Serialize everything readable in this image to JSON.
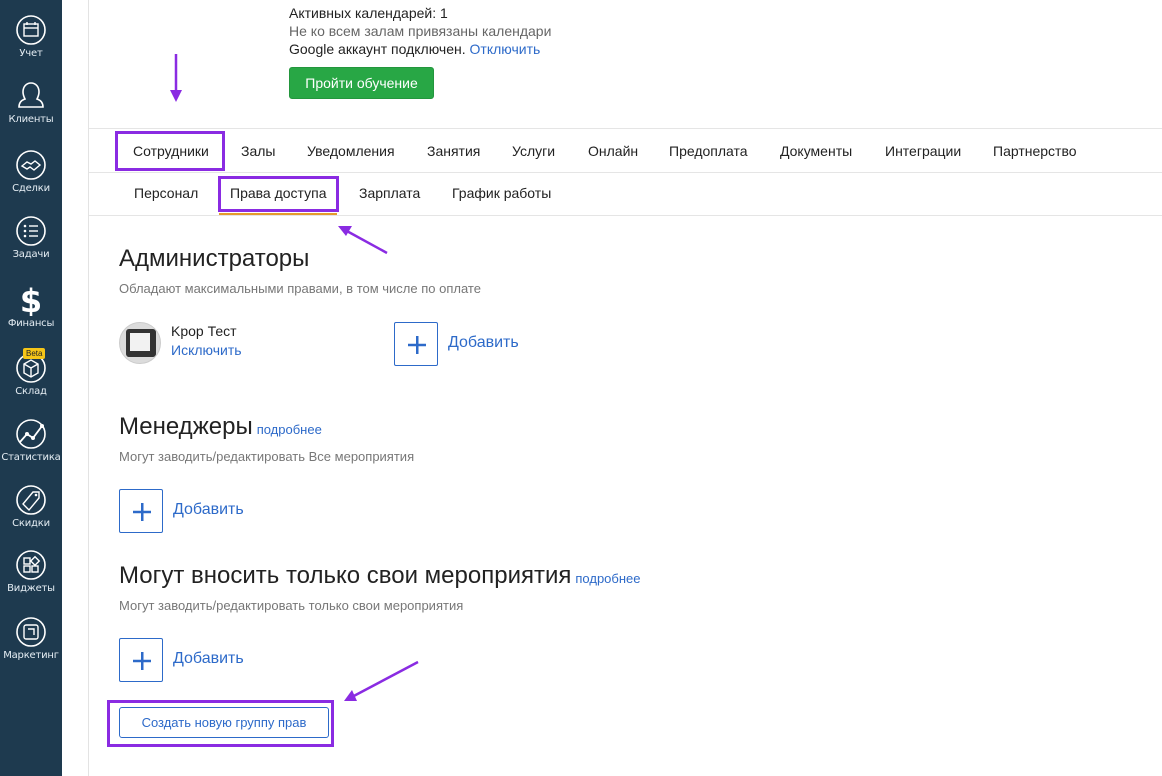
{
  "sidebar": {
    "items": [
      {
        "label": "Учет",
        "icon": "calendar-icon"
      },
      {
        "label": "Клиенты",
        "icon": "person-icon"
      },
      {
        "label": "Сделки",
        "icon": "handshake-icon"
      },
      {
        "label": "Задачи",
        "icon": "checklist-icon"
      },
      {
        "label": "Финансы",
        "icon": "dollar-icon"
      },
      {
        "label": "Склад",
        "icon": "box-icon",
        "badge": "Beta"
      },
      {
        "label": "Статистика",
        "icon": "chart-icon"
      },
      {
        "label": "Скидки",
        "icon": "sale-tag-icon"
      },
      {
        "label": "Виджеты",
        "icon": "widgets-icon"
      },
      {
        "label": "Маркетинг",
        "icon": "marketing-icon"
      }
    ]
  },
  "calendar_info": {
    "active_calendars": "Активных календарей: 1",
    "not_all_halls": "Не ко всем залам привязаны календари",
    "google_connected": "Google аккаунт подключен.",
    "disconnect_link": "Отключить",
    "training_button": "Пройти обучение"
  },
  "main_tabs": [
    "Сотрудники",
    "Залы",
    "Уведомления",
    "Занятия",
    "Услуги",
    "Онлайн",
    "Предоплата",
    "Документы",
    "Интеграции",
    "Партнерство"
  ],
  "sub_tabs": [
    "Персонал",
    "Права доступа",
    "Зарплата",
    "График работы"
  ],
  "sections": {
    "admins": {
      "title": "Администраторы",
      "desc": "Обладают максимальными правами, в том числе по оплате",
      "user_name": "Kpop Тест",
      "exclude_link": "Исключить",
      "add_label": "Добавить"
    },
    "managers": {
      "title": "Менеджеры",
      "more": "подробнее",
      "desc": "Могут заводить/редактировать Все мероприятия",
      "add_label": "Добавить"
    },
    "own_events": {
      "title": "Могут вносить только свои мероприятия",
      "more": "подробнее",
      "desc": "Могут заводить/редактировать только свои мероприятия",
      "add_label": "Добавить"
    }
  },
  "create_group_button": "Создать новую группу прав",
  "colors": {
    "sidebar_bg": "#1e3a4f",
    "accent_link": "#2d6ac9",
    "green_button": "#28a745",
    "highlight": "#8a2be2",
    "active_tab_underline": "#e49a2d"
  }
}
